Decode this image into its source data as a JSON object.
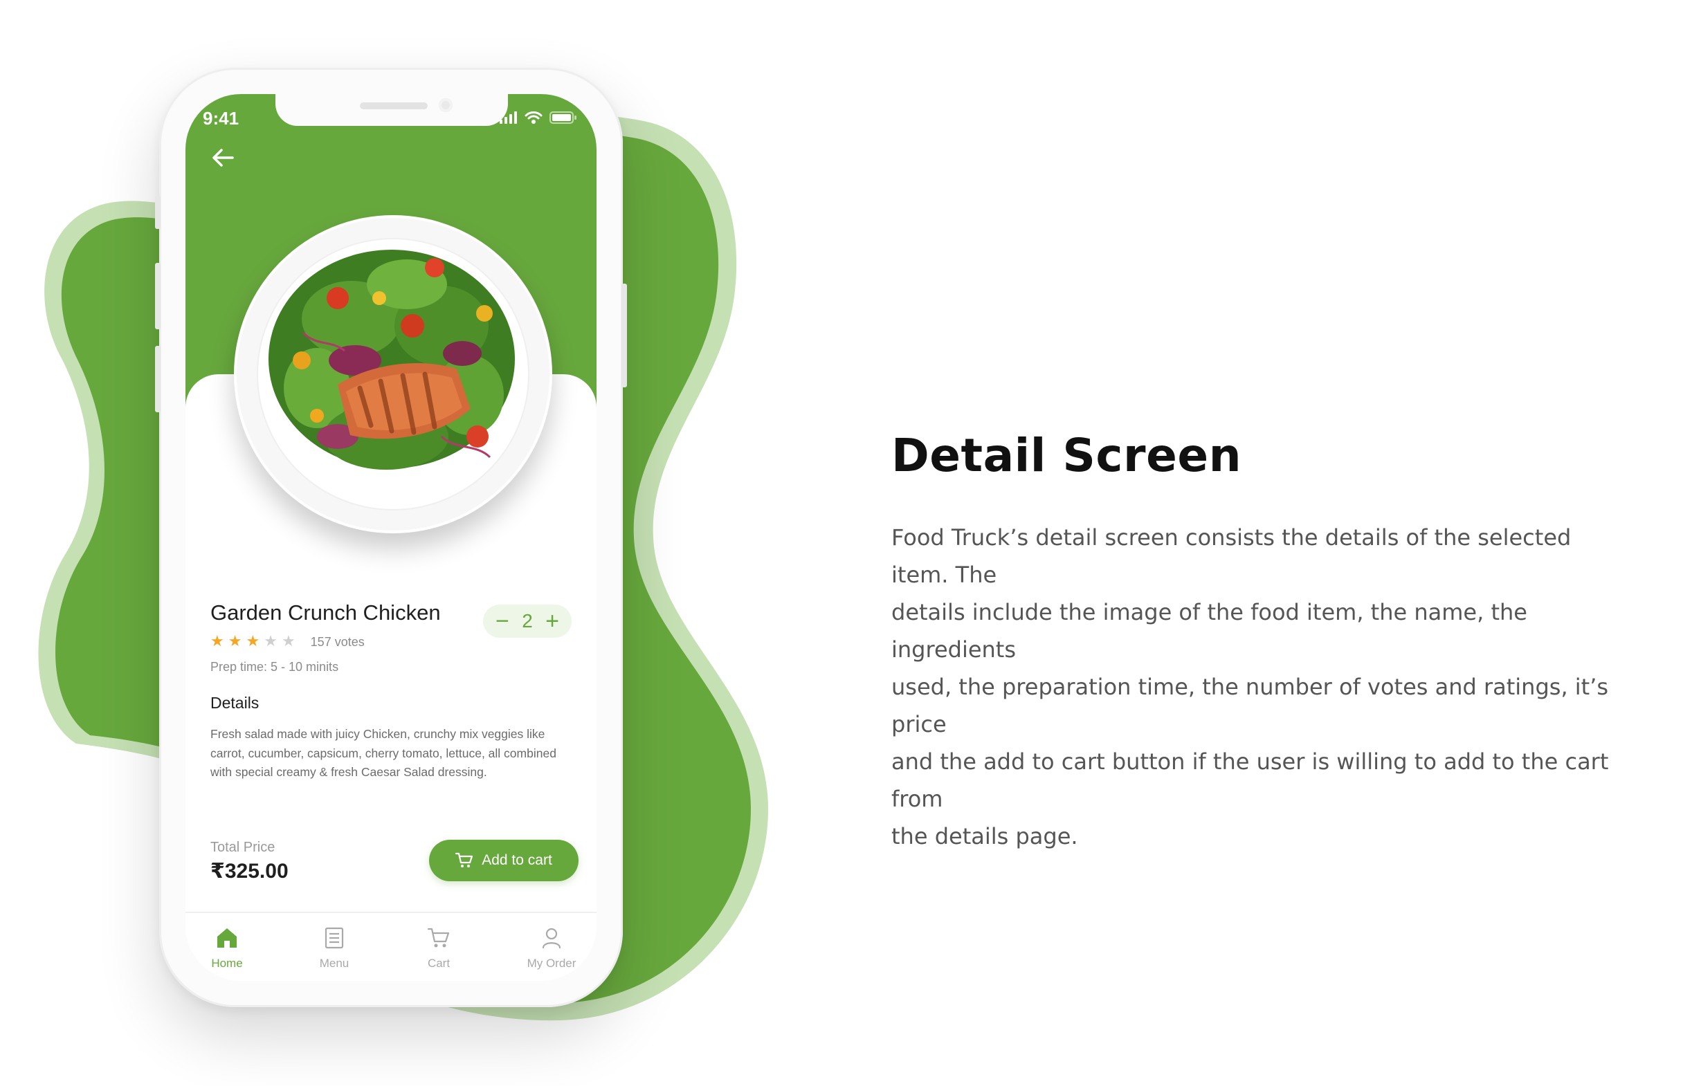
{
  "colors": {
    "brand_green": "#67a83d",
    "light_green": "#c5e0b3",
    "star_filled": "#f5a623",
    "star_empty": "#cfcfcf"
  },
  "status_bar": {
    "time": "9:41",
    "icons": [
      "signal-icon",
      "wifi-icon",
      "battery-icon"
    ]
  },
  "product": {
    "name": "Garden Crunch Chicken",
    "rating": 3,
    "rating_max": 5,
    "votes": "157 votes",
    "prep_time": "Prep time: 5 - 10 minits",
    "quantity": "2",
    "details_title": "Details",
    "details_text": "Fresh salad made with juicy Chicken, crunchy mix veggies like carrot, cucumber, capsicum, cherry tomato, lettuce, all combined with special creamy & fresh Caesar Salad dressing.",
    "total_label": "Total Price",
    "total_price": "₹325.00",
    "add_to_cart": "Add to cart"
  },
  "tabbar": {
    "items": [
      {
        "label": "Home",
        "icon": "home-icon",
        "active": true
      },
      {
        "label": "Menu",
        "icon": "menu-icon",
        "active": false
      },
      {
        "label": "Cart",
        "icon": "cart-icon",
        "active": false
      },
      {
        "label": "My Order",
        "icon": "user-icon",
        "active": false
      }
    ]
  },
  "showcase": {
    "title": "Detail Screen",
    "description_lines": [
      "Food Truck’s detail screen consists the details of the selected item. The",
      "details include the image of the food item, the name, the ingredients",
      "used, the preparation time, the number of votes and ratings, it’s price",
      "and the add to cart button if the user is willing to add to the cart from",
      "the details page."
    ]
  }
}
